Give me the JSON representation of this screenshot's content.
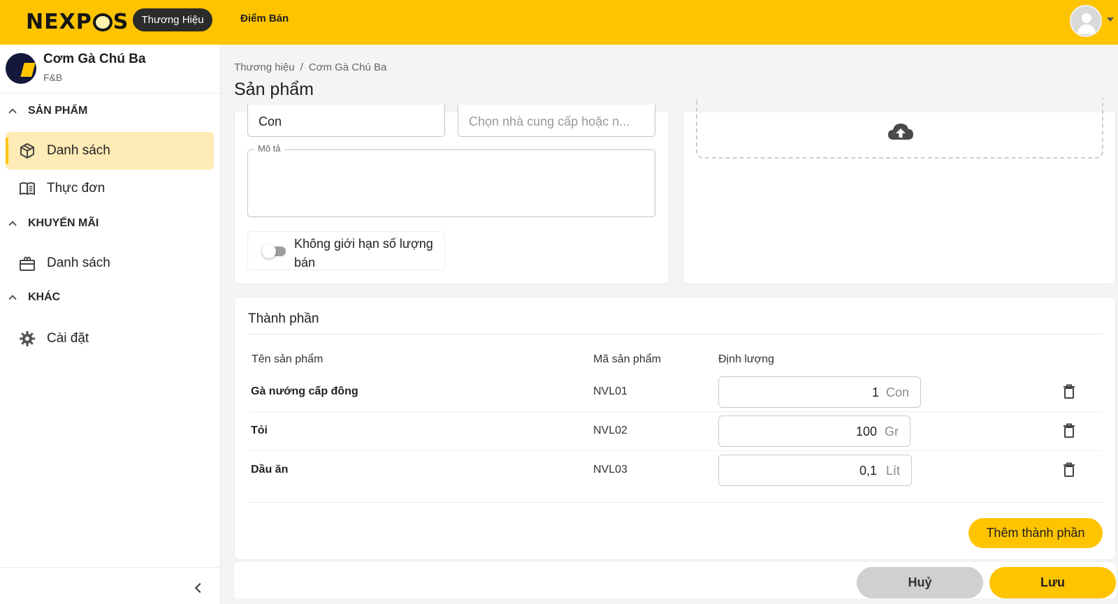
{
  "header": {
    "logo_text_1": "NEXP",
    "logo_text_2": "S",
    "tab_brand": "Thương Hiệu",
    "tab_pos": "Điểm Bán"
  },
  "sidebar": {
    "brand_name": "Cơm Gà Chú Ba",
    "brand_type": "F&B",
    "sections": [
      {
        "title": "SẢN PHẨM",
        "items": [
          {
            "label": "Danh sách",
            "icon": "box-icon",
            "active": true
          },
          {
            "label": "Thực đơn",
            "icon": "menu-book-icon"
          }
        ]
      },
      {
        "title": "KHUYẾN MÃI",
        "items": [
          {
            "label": "Danh sách",
            "icon": "gift-icon"
          }
        ]
      },
      {
        "title": "KHÁC",
        "items": [
          {
            "label": "Cài đặt",
            "icon": "gear-icon"
          }
        ]
      }
    ]
  },
  "breadcrumb": {
    "items": [
      "Thương hiệu",
      "Cơm Gà Chú Ba"
    ],
    "separator": "/"
  },
  "page_title": "Sản phẩm",
  "form": {
    "unit_value": "Con",
    "supplier_placeholder": "Chọn nhà cung cấp hoặc n...",
    "description_label": "Mô tả",
    "description_value": "",
    "unlimited_label": "Không giới hạn số lượng bán",
    "unlimited_on": false
  },
  "ingredients": {
    "title": "Thành phần",
    "columns": [
      "Tên sản phẩm",
      "Mã sản phẩm",
      "Định lượng"
    ],
    "rows": [
      {
        "name": "Gà nướng cấp đông",
        "code": "NVL01",
        "qty": "1",
        "unit": "Con"
      },
      {
        "name": "Tỏi",
        "code": "NVL02",
        "qty": "100",
        "unit": "Gr"
      },
      {
        "name": "Dầu ăn",
        "code": "NVL03",
        "qty": "0,1",
        "unit": "Lít"
      }
    ],
    "add_button": "Thêm thành phần"
  },
  "footer": {
    "cancel": "Huỷ",
    "save": "Lưu"
  },
  "colors": {
    "accent": "#FFC400",
    "accent_soft": "#FFEBB5",
    "dark_pill": "#2b2b2b"
  }
}
